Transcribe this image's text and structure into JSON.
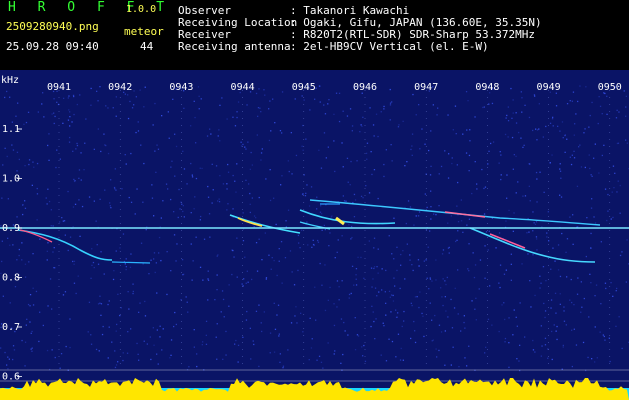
{
  "header": {
    "brand": "H R O F F T",
    "version": "1.0.0",
    "filename": "2509280940.png",
    "datetime": "25.09.28 09:40",
    "meteor_label": "meteor",
    "meteor_count": "44"
  },
  "info": [
    {
      "key": "Observer",
      "value": ": Takanori Kawachi"
    },
    {
      "key": "Receiving Location",
      "value": ": Ogaki, Gifu, JAPAN (136.60E, 35.35N)"
    },
    {
      "key": "Receiver",
      "value": ": R820T2(RTL-SDR) SDR-Sharp 53.372MHz"
    },
    {
      "key": "Receiving antenna",
      "value": ": 2el-HB9CV Vertical (el. E-W)"
    }
  ],
  "chart_data": {
    "type": "heatmap",
    "ylabel": "kHz",
    "y_ticks": [
      "1.1",
      "1.0",
      "0.9",
      "0.8",
      "0.7",
      "0.6"
    ],
    "x_ticks": [
      "0941",
      "0942",
      "0943",
      "0944",
      "0945",
      "0946",
      "0947",
      "0948",
      "0949",
      "0950"
    ],
    "background_color": "#0a1466",
    "noise_color": "#3c5aff",
    "carrier_color": "#7be6ff",
    "level_color": "#ffe600",
    "baseline_color": "#18d8ff"
  }
}
